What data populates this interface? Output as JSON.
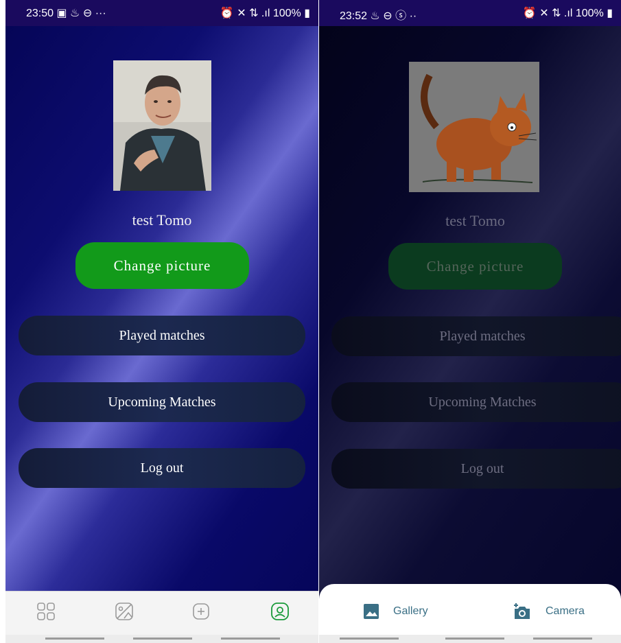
{
  "left": {
    "status_time": "23:50 ▣ ♨ ⊖ ···",
    "status_indicators": "⏰ ✕ ⇅ .ıl 100% ▮",
    "username": "test Tomo",
    "change_picture": "Change picture",
    "menu": [
      "Played matches",
      "Upcoming Matches",
      "Log out"
    ],
    "bottom_nav": [
      "grid-icon",
      "image-icon",
      "add-icon",
      "profile-icon"
    ],
    "active_color": "#1a9a3a"
  },
  "right": {
    "status_time": "23:52 ♨ ⊖ ⓢ ··",
    "status_indicators": "⏰ ✕ ⇅ .ıl 100% ▮",
    "username": "test Tomo",
    "change_picture": "Change picture",
    "menu": [
      "Played matches",
      "Upcoming Matches",
      "Log out"
    ],
    "sheet": {
      "gallery": "Gallery",
      "camera": "Camera"
    }
  },
  "colors": {
    "accent_green": "#129a1a",
    "sheet_text": "#3a6f85",
    "statusbar": "#1a0a5e"
  }
}
